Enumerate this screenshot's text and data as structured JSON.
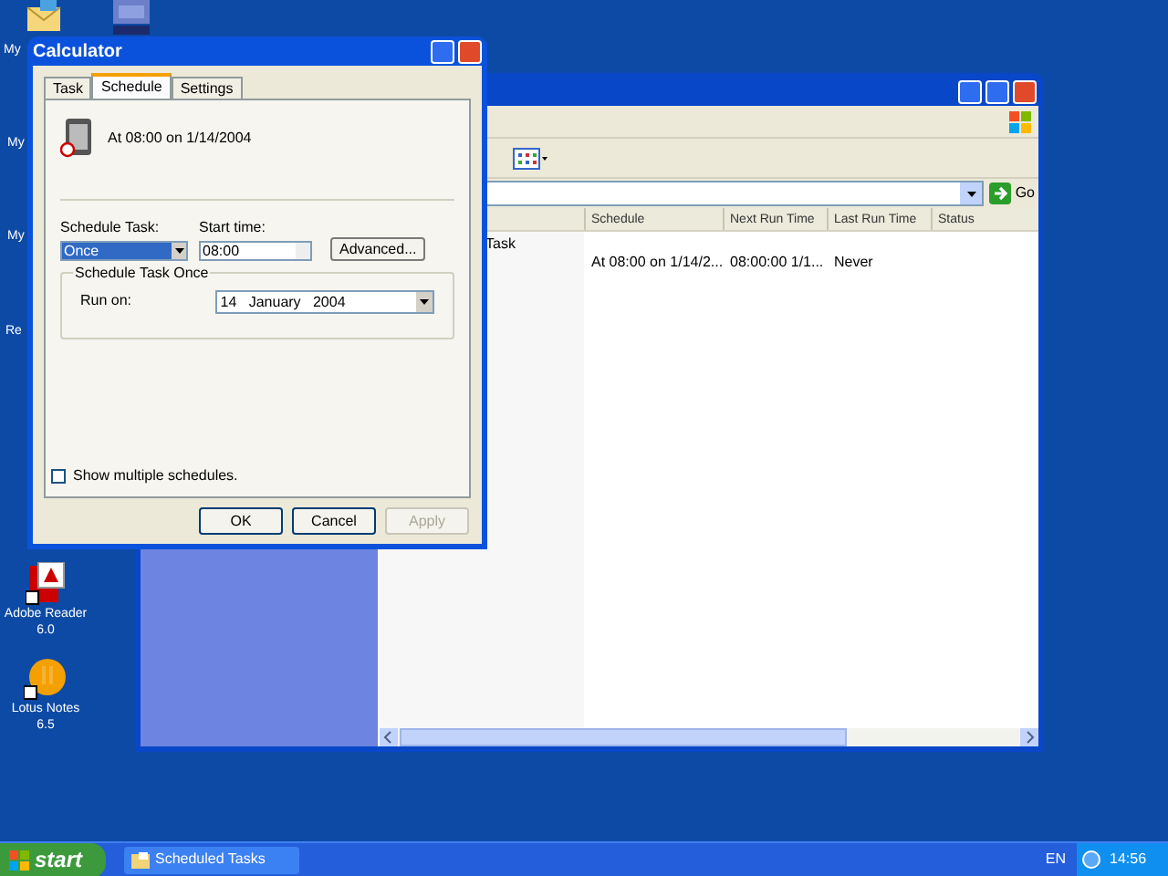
{
  "desktop": {
    "cut_labels": [
      "My",
      "My",
      "My",
      "Re"
    ],
    "icons": [
      {
        "kind": "pdf",
        "lines": [
          "Adobe Reader",
          "6.0"
        ]
      },
      {
        "kind": "notes",
        "lines": [
          "Lotus Notes",
          "6.5"
        ]
      }
    ]
  },
  "explorer": {
    "go": "Go",
    "columns": [
      "Schedule",
      "Next Run Time",
      "Last Run Time",
      "Status"
    ],
    "rows": [
      {
        "name": "Task",
        "cells": [
          "At 08:00 on 1/14/2...",
          "08:00:00  1/1...",
          "Never",
          ""
        ]
      }
    ]
  },
  "dialog": {
    "title": "Calculator",
    "tabs": [
      {
        "label": "Task",
        "selected": false
      },
      {
        "label": "Schedule",
        "selected": true
      },
      {
        "label": "Settings",
        "selected": false
      }
    ],
    "summary": "At 08:00 on 1/14/2004",
    "schedule_label": "Schedule Task:",
    "schedule_value": "Once",
    "start_label": "Start time:",
    "start_value": "08:00",
    "advanced": "Advanced...",
    "group_title": "Schedule Task Once",
    "run_on_label": "Run on:",
    "run_on_value": "14   January   2004",
    "show_multiple": {
      "label": "Show multiple schedules.",
      "checked": false
    },
    "buttons": [
      {
        "label": "OK",
        "disabled": false
      },
      {
        "label": "Cancel",
        "disabled": false
      },
      {
        "label": "Apply",
        "disabled": true
      }
    ]
  },
  "taskbar": {
    "start": "start",
    "tasks": [
      {
        "label": "Scheduled Tasks"
      }
    ],
    "language": "EN",
    "clock": "14:56"
  }
}
